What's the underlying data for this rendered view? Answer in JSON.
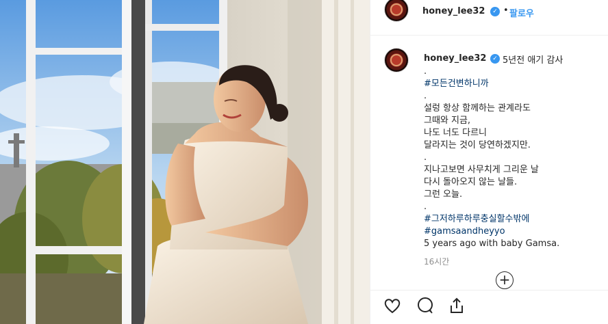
{
  "post": {
    "username": "honey_lee32",
    "verified_icon": "verified-badge-icon",
    "separator": "•",
    "follow_label": "팔로우"
  },
  "caption": {
    "username": "honey_lee32",
    "first_line": "5년전 애기 감사",
    "lines": [
      ".",
      "#모든건변하니까",
      ".",
      "설렁 항상 함께하는 관계라도",
      "그때와 지금,",
      "나도 너도 다르니",
      "달라지는 것이 당연하겠지만.",
      ".",
      "지나고보면 사무치게 그리운 날",
      "다시 돌아오지 않는 날들.",
      "그런 오늘.",
      ".",
      "#그저하루하루충실할수밖에",
      "#gamsaandheyyo",
      "5 years ago with baby Gamsa."
    ],
    "time": "16시간"
  },
  "actions": {
    "load_more": "+",
    "icons": [
      "heart-icon",
      "comment-icon",
      "share-icon"
    ]
  },
  "colors": {
    "link": "#3897f0",
    "hashtag": "#003569",
    "text": "#262626",
    "muted": "#8e8e8e"
  }
}
